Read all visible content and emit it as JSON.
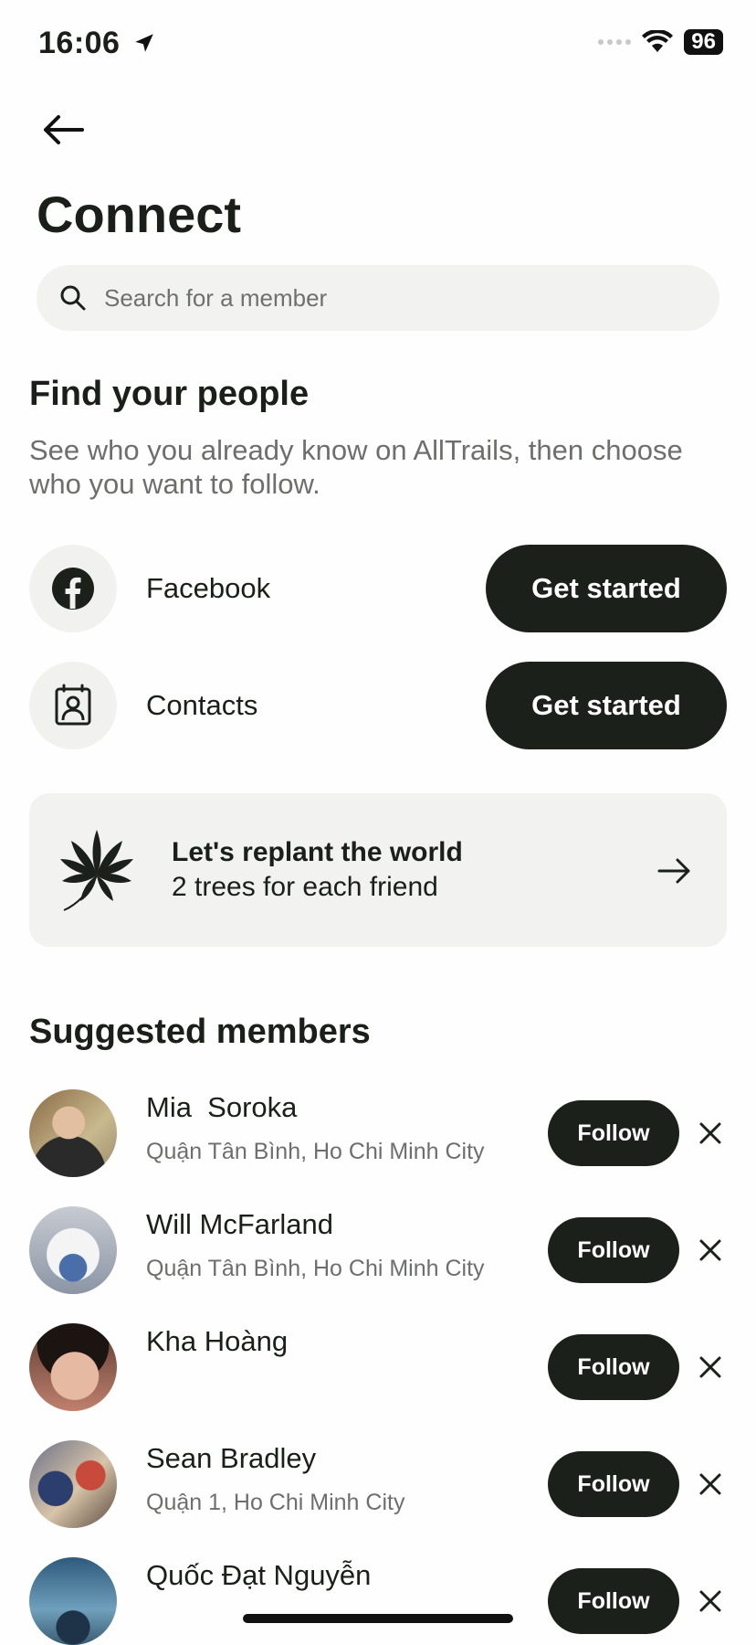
{
  "status": {
    "time": "16:06",
    "battery": "96"
  },
  "title": "Connect",
  "search": {
    "placeholder": "Search for a member"
  },
  "find_people": {
    "heading": "Find your people",
    "description": "See who you already know on AllTrails, then choose who you want to follow.",
    "sources": [
      {
        "label": "Facebook",
        "icon": "facebook-icon",
        "button": "Get started"
      },
      {
        "label": "Contacts",
        "icon": "contacts-icon",
        "button": "Get started"
      }
    ]
  },
  "promo": {
    "title": "Let's replant the world",
    "subtitle": "2 trees for each friend",
    "icon": "leaf-icon"
  },
  "suggested": {
    "heading": "Suggested members",
    "follow_label": "Follow",
    "members": [
      {
        "name": "Mia  Soroka",
        "location": "Quận Tân Bình, Ho Chi Minh City"
      },
      {
        "name": "Will McFarland",
        "location": "Quận Tân Bình, Ho Chi Minh City"
      },
      {
        "name": "Kha Hoàng",
        "location": ""
      },
      {
        "name": "Sean Bradley",
        "location": "Quận 1, Ho Chi Minh City"
      },
      {
        "name": "Quốc Đạt Nguyễn",
        "location": ""
      }
    ]
  },
  "colors": {
    "primary": "#1b211a",
    "surface": "#f2f2f1",
    "secondary_text": "#6c6f6c"
  }
}
